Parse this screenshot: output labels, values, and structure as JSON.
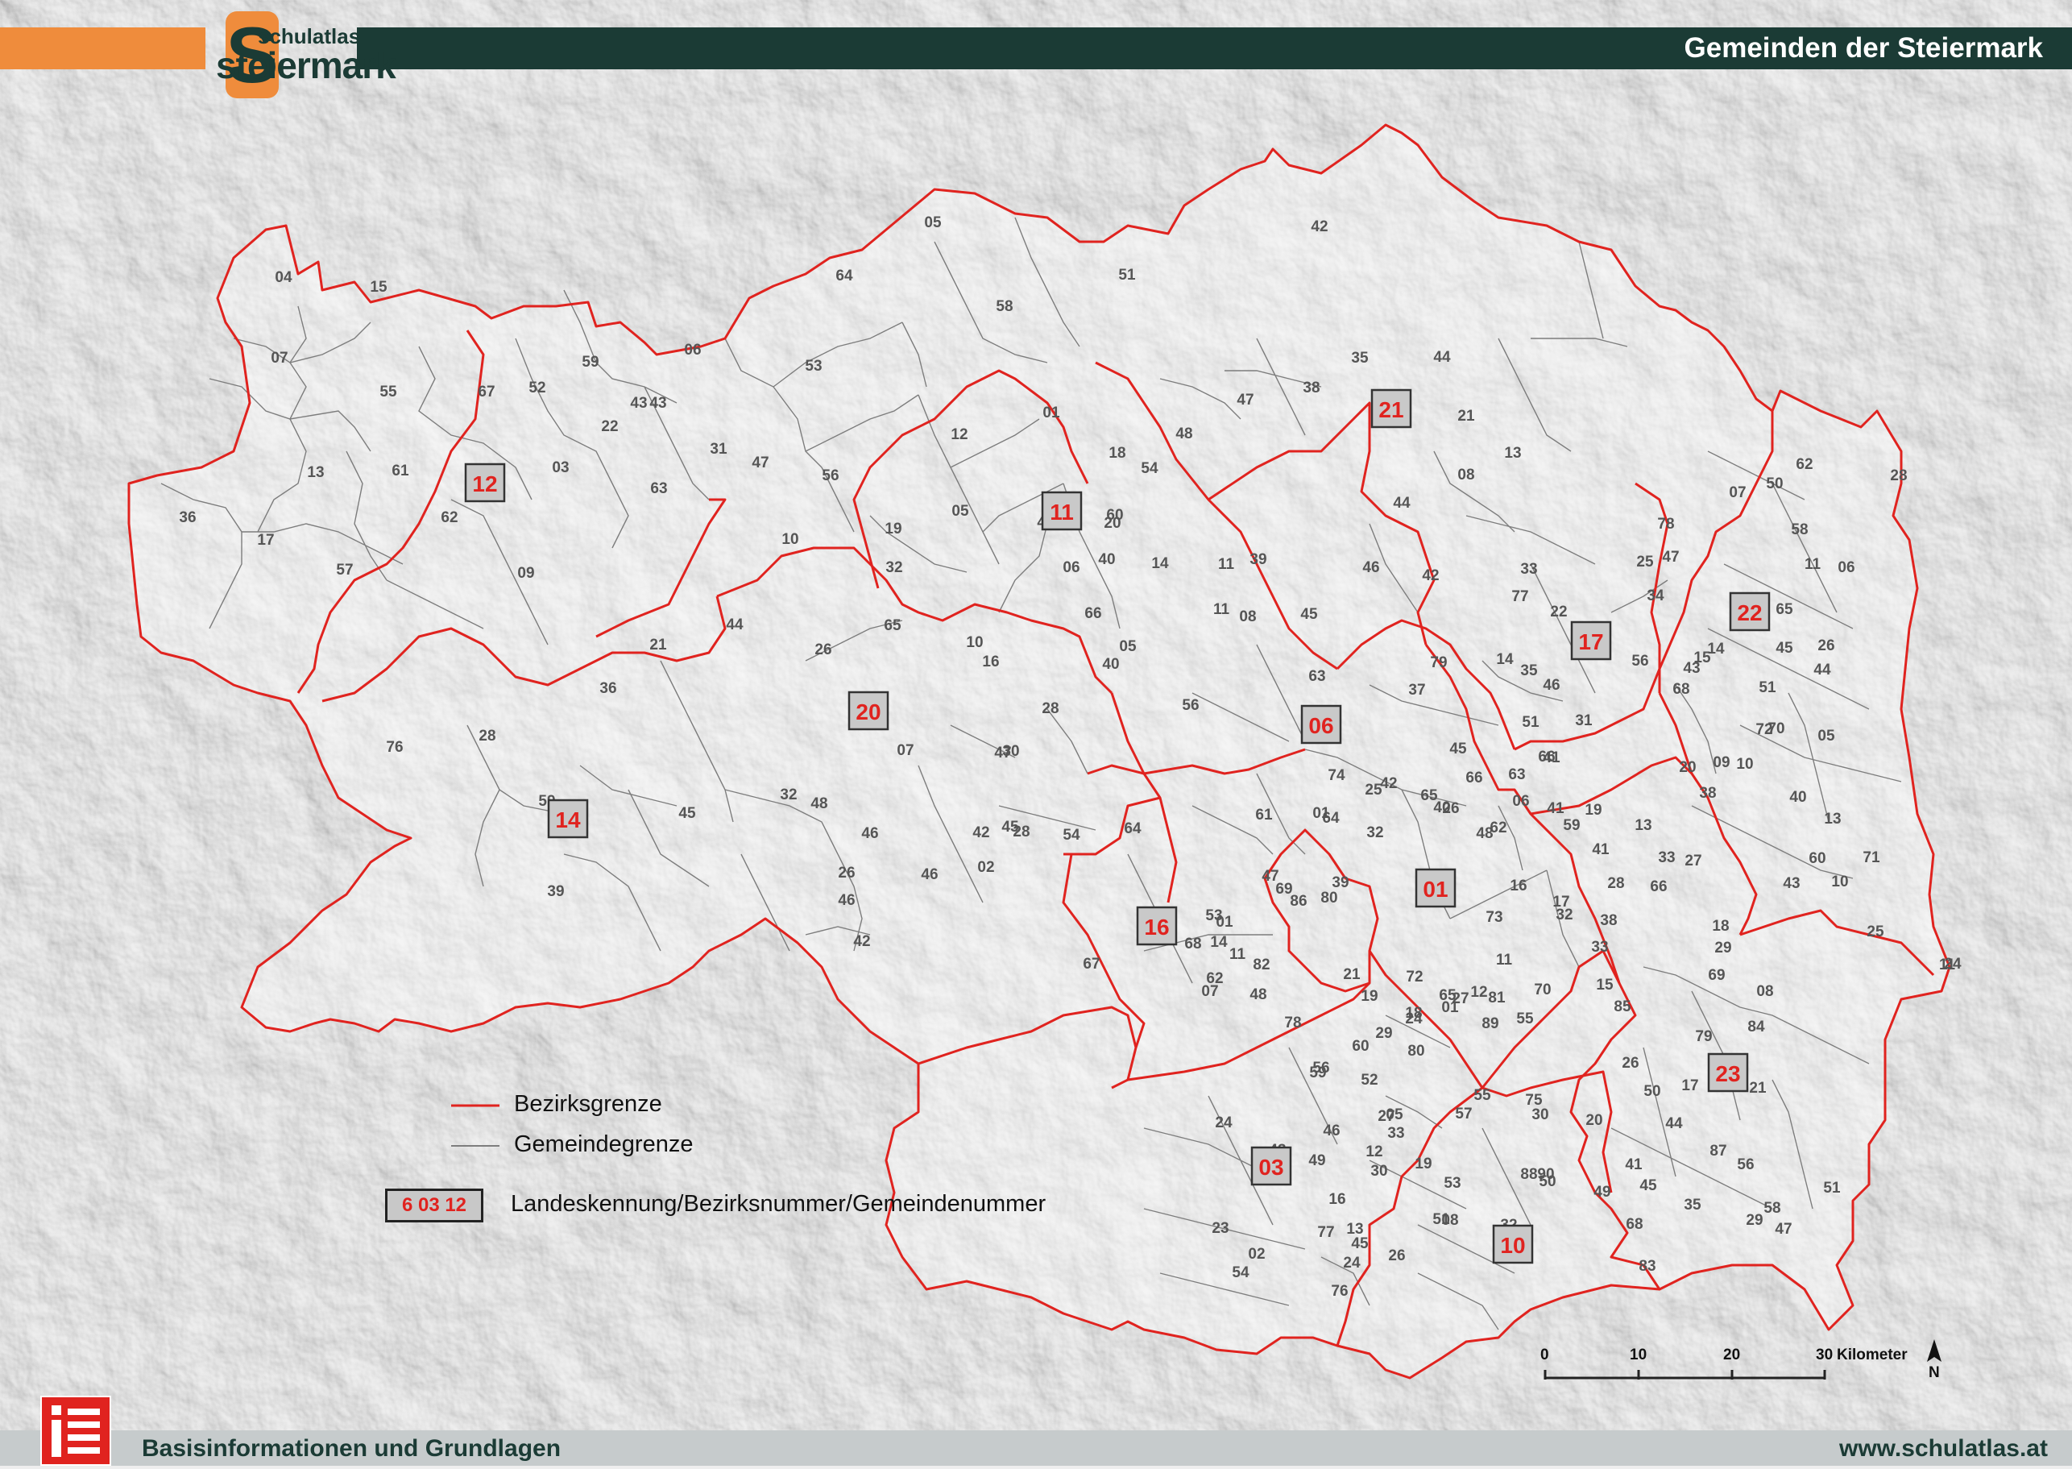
{
  "header": {
    "title": "Gemeinden der Steiermark",
    "logo_small": "schulatlas",
    "logo_big": "steiermark",
    "logo_letter": "S"
  },
  "footer": {
    "left": "Basisinformationen und Grundlagen",
    "right": "www.schulatlas.at"
  },
  "legend": {
    "district_border": "Bezirksgrenze",
    "municipality_border": "Gemeindegrenze",
    "sample_code": "6 03 12",
    "code_explanation": "Landeskennung/Bezirksnummer/Gemeindenummer"
  },
  "scale": {
    "ticks": [
      "0",
      "10",
      "20",
      "30"
    ],
    "unit": "Kilometer",
    "north": "N"
  },
  "colors": {
    "district_border": "#e0231f",
    "municipality_border": "#7d7d7d",
    "header_green": "#1b3b35",
    "header_orange": "#ef8c3c",
    "label_red": "#e0231f",
    "label_gray": "#555555"
  },
  "districts": [
    "12",
    "11",
    "21",
    "20",
    "14",
    "06",
    "17",
    "22",
    "16",
    "01",
    "03",
    "10",
    "23"
  ],
  "municipalities": [
    "04",
    "15",
    "05",
    "64",
    "51",
    "42",
    "44",
    "58",
    "07",
    "55",
    "59",
    "06",
    "53",
    "43",
    "31",
    "67",
    "52",
    "43",
    "22",
    "35",
    "38",
    "21",
    "48",
    "47",
    "13",
    "61",
    "03",
    "12",
    "01",
    "18",
    "63",
    "47",
    "56",
    "19",
    "05",
    "41",
    "36",
    "17",
    "62",
    "10",
    "20",
    "40",
    "32",
    "54",
    "60",
    "57",
    "09",
    "11",
    "46",
    "06",
    "14",
    "65",
    "66",
    "21",
    "44",
    "08",
    "45",
    "10",
    "16",
    "05",
    "11",
    "39",
    "44",
    "08",
    "13",
    "42",
    "79",
    "33",
    "47",
    "07",
    "62",
    "28",
    "50",
    "78",
    "25",
    "15",
    "65",
    "11",
    "58",
    "77",
    "22",
    "34",
    "45",
    "63",
    "51",
    "35",
    "68",
    "56",
    "14",
    "26",
    "51",
    "06",
    "45",
    "19",
    "44",
    "43",
    "63",
    "20",
    "37",
    "14",
    "10",
    "72",
    "05",
    "76",
    "36",
    "26",
    "28",
    "40",
    "56",
    "28",
    "07",
    "47",
    "46",
    "31",
    "66",
    "70",
    "09",
    "41",
    "30",
    "59",
    "32",
    "25",
    "40",
    "64",
    "74",
    "38",
    "40",
    "45",
    "54",
    "42",
    "26",
    "65",
    "66",
    "06",
    "41",
    "13",
    "45",
    "48",
    "46",
    "42",
    "64",
    "61",
    "01",
    "62",
    "59",
    "13",
    "33",
    "26",
    "46",
    "02",
    "28",
    "47",
    "32",
    "48",
    "41",
    "27",
    "60",
    "71",
    "43",
    "39",
    "46",
    "69",
    "39",
    "17",
    "28",
    "66",
    "10",
    "01",
    "19",
    "16",
    "32",
    "80",
    "38",
    "18",
    "25",
    "42",
    "67",
    "53",
    "68",
    "14",
    "11",
    "86",
    "73",
    "29",
    "24",
    "21",
    "11",
    "33",
    "69",
    "08",
    "11",
    "19",
    "82",
    "72",
    "65",
    "12",
    "15",
    "62",
    "07",
    "27",
    "81",
    "70",
    "18",
    "29",
    "24",
    "60",
    "56",
    "55",
    "85",
    "84",
    "79",
    "78",
    "48",
    "01",
    "89",
    "80",
    "26",
    "52",
    "55",
    "59",
    "75",
    "50",
    "17",
    "20",
    "21",
    "27",
    "57",
    "30",
    "44",
    "24",
    "46",
    "05",
    "41",
    "33",
    "43",
    "12",
    "88",
    "90",
    "87",
    "32",
    "49",
    "30",
    "19",
    "53",
    "08",
    "56",
    "51",
    "16",
    "45",
    "77",
    "68",
    "35",
    "29",
    "47",
    "23",
    "13",
    "51",
    "32",
    "50",
    "49",
    "58",
    "83",
    "26",
    "45",
    "24",
    "02",
    "54",
    "76"
  ],
  "landmarks": [
    "steiermark"
  ]
}
